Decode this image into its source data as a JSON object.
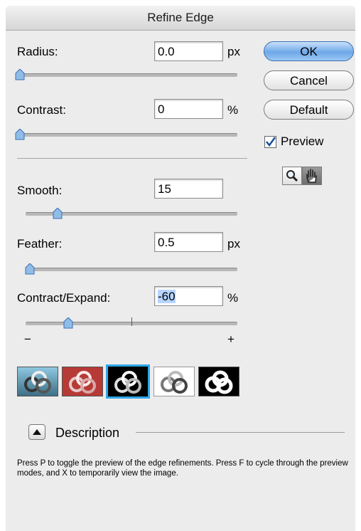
{
  "window": {
    "title": "Refine Edge"
  },
  "controls": {
    "radius": {
      "label": "Radius:",
      "value": "0.0",
      "unit": "px",
      "slider": 0.0
    },
    "contrast": {
      "label": "Contrast:",
      "value": "0",
      "unit": "%",
      "slider": 0.0
    },
    "smooth": {
      "label": "Smooth:",
      "value": "15",
      "slider": 0.15
    },
    "feather": {
      "label": "Feather:",
      "value": "0.5",
      "unit": "px",
      "slider": 0.02
    },
    "contract": {
      "label": "Contract/Expand:",
      "value": "-60",
      "unit": "%",
      "slider": 0.2,
      "min_label": "−",
      "max_label": "+"
    }
  },
  "buttons": {
    "ok": "OK",
    "cancel": "Cancel",
    "default": "Default"
  },
  "preview": {
    "label": "Preview",
    "checked": true
  },
  "tools": [
    "zoom-icon",
    "hand-icon"
  ],
  "preview_modes": [
    {
      "name": "standard",
      "selected": false
    },
    {
      "name": "quick-mask",
      "selected": false
    },
    {
      "name": "on-black",
      "selected": true
    },
    {
      "name": "on-white",
      "selected": false
    },
    {
      "name": "mask",
      "selected": false
    }
  ],
  "description": {
    "toggle_label": "Description",
    "text": "Press P to toggle the preview of the edge refinements. Press F to cycle through the preview modes, and X to temporarily view the image."
  },
  "colors": {
    "default_button": "#6ea8e8",
    "selected_mode": "#2fa8e8",
    "slider_knob": "#8fbde8"
  }
}
